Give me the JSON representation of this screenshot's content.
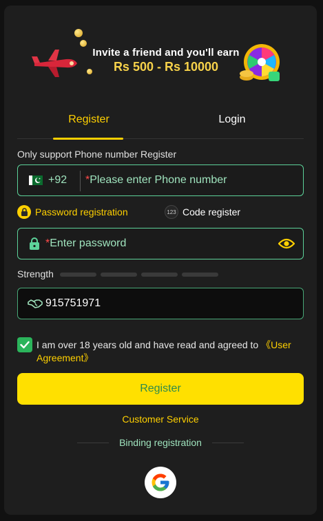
{
  "banner": {
    "line1": "Invite a friend and you'll earn",
    "line2": "Rs 500 - Rs 10000"
  },
  "tabs": [
    {
      "label": "Register",
      "active": true
    },
    {
      "label": "Login",
      "active": false
    }
  ],
  "hint": "Only support Phone number Register",
  "phone": {
    "country_code": "+92",
    "flag_icon": "pakistan-flag-icon",
    "required_mark": "*",
    "placeholder": "Please enter Phone number"
  },
  "modes": {
    "password_label": "Password registration",
    "code_label": "Code register",
    "code_badge": "123"
  },
  "password": {
    "required_mark": "*",
    "placeholder": "Enter password"
  },
  "strength": {
    "label": "Strength",
    "level": 0,
    "segments": 4
  },
  "invite": {
    "value": "915751971",
    "icon": "handshake-icon"
  },
  "agreement": {
    "checked": true,
    "text": "I am over 18 years old and have read and agreed to ",
    "link": "《User Agreement》"
  },
  "register_button": "Register",
  "customer_service": "Customer Service",
  "binding_label": "Binding registration",
  "social": [
    {
      "name": "google",
      "icon": "google-icon"
    }
  ],
  "colors": {
    "accent": "#ffd000",
    "field_border": "#5dd39a",
    "button_bg": "#ffe000",
    "button_text": "#2e8a4c",
    "background": "#1e1e1e"
  }
}
